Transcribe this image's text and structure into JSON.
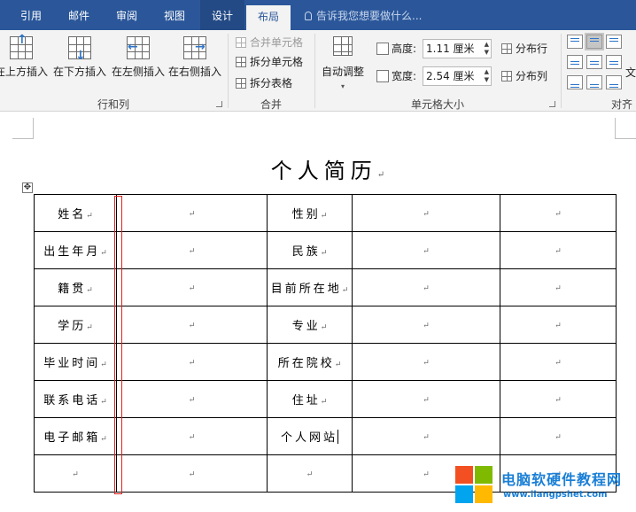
{
  "tabs": [
    {
      "label": "引用"
    },
    {
      "label": "邮件"
    },
    {
      "label": "审阅"
    },
    {
      "label": "视图"
    },
    {
      "label": "设计"
    },
    {
      "label": "布局"
    }
  ],
  "tell_me": "告诉我您想要做什么...",
  "ribbon": {
    "rows_cols": {
      "label": "行和列",
      "insert_above": "在上方插入",
      "insert_below": "在下方插入",
      "insert_left": "在左侧插入",
      "insert_right": "在右侧插入"
    },
    "merge": {
      "label": "合并",
      "merge_cells": "合并单元格",
      "split_cells": "拆分单元格",
      "split_table": "拆分表格"
    },
    "cell_size": {
      "label": "单元格大小",
      "autofit": "自动调整",
      "height_label": "高度:",
      "height_value": "1.11 厘米",
      "width_label": "宽度:",
      "width_value": "2.54 厘米",
      "distribute_rows": "分布行",
      "distribute_cols": "分布列"
    },
    "alignment": {
      "label": "对齐",
      "text_dir_fragment": "文"
    }
  },
  "document": {
    "title": "个人简历",
    "para_mark": "↵",
    "rows": [
      [
        "姓名",
        "",
        "性别",
        "",
        ""
      ],
      [
        "出生年月",
        "",
        "民族",
        "",
        ""
      ],
      [
        "籍贯",
        "",
        "目前所在地",
        "",
        ""
      ],
      [
        "学历",
        "",
        "专业",
        "",
        ""
      ],
      [
        "毕业时间",
        "",
        "所在院校",
        "",
        ""
      ],
      [
        "联系电话",
        "",
        "住址",
        "",
        ""
      ],
      [
        "电子邮箱",
        "",
        "个人网站",
        "",
        ""
      ],
      [
        "",
        "",
        "",
        "",
        ""
      ]
    ]
  },
  "watermark": {
    "title": "电脑软硬件教程网",
    "url": "www.liangpshet.com"
  }
}
